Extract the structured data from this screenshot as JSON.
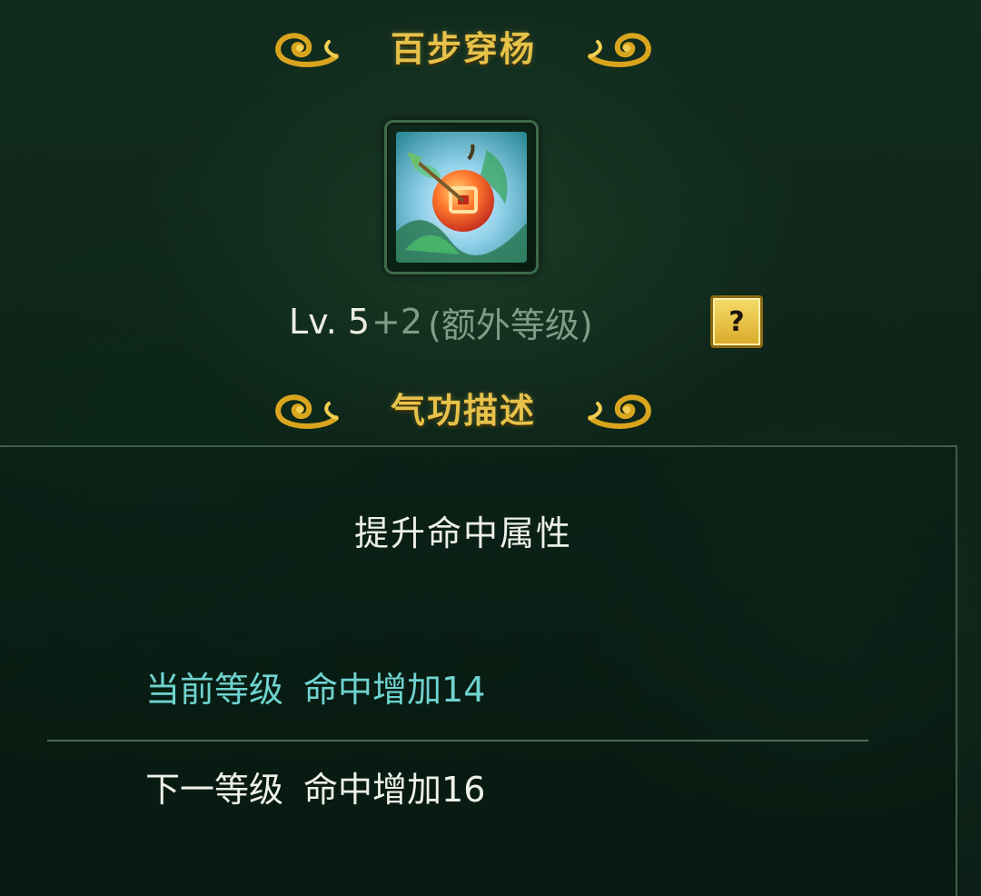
{
  "skill": {
    "name": "百步穿杨",
    "icon": "target-apple-arrow-icon",
    "level": {
      "base": "Lv. 5",
      "extra": "+2",
      "extra_note": "(额外等级)"
    },
    "help_label": "?"
  },
  "description": {
    "section_title": "气功描述",
    "summary": "提升命中属性",
    "current": {
      "label": "当前等级",
      "effect": "命中增加14"
    },
    "next": {
      "label": "下一等级",
      "effect": "命中增加16"
    }
  },
  "colors": {
    "title_gold": "#e6c24a",
    "current_level_text": "#6fd3cf",
    "extra_level_text": "#7f9c88",
    "body_text": "#eef0ea"
  }
}
